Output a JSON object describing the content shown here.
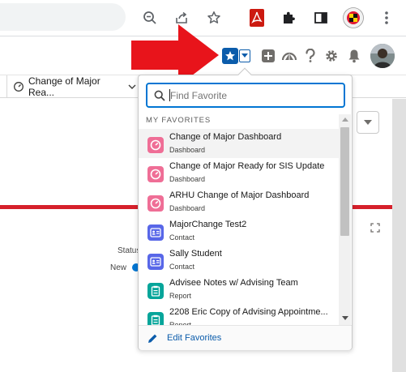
{
  "browser": {
    "toolbar_icons": [
      "zoom-icon",
      "share-icon",
      "bookmark-star-icon",
      "pdf-extension-icon",
      "extensions-puzzle-icon",
      "side-panel-icon",
      "profile-seal-icon"
    ]
  },
  "salesforce_header": {
    "icons": [
      "favorites-star-icon",
      "favorites-dropdown-icon",
      "global-actions-icon",
      "trailhead-icon",
      "help-icon",
      "setup-gear-icon",
      "notifications-bell-icon",
      "user-avatar"
    ]
  },
  "nav": {
    "tab_label": "Change of Major Rea..."
  },
  "page": {
    "status_label": "Status",
    "new_label": "New"
  },
  "favorites": {
    "search_placeholder": "Find Favorite",
    "section_title": "MY FAVORITES",
    "items": [
      {
        "title": "Change of Major Dashboard",
        "type": "Dashboard",
        "icon": "dashboard-icon",
        "color": "#ef6e96"
      },
      {
        "title": "Change of Major Ready for SIS Update",
        "type": "Dashboard",
        "icon": "dashboard-icon",
        "color": "#ef6e96"
      },
      {
        "title": "ARHU Change of Major Dashboard",
        "type": "Dashboard",
        "icon": "dashboard-icon",
        "color": "#ef6e96"
      },
      {
        "title": "MajorChange Test2",
        "type": "Contact",
        "icon": "contact-icon",
        "color": "#5867e8"
      },
      {
        "title": "Sally Student",
        "type": "Contact",
        "icon": "contact-icon",
        "color": "#5867e8"
      },
      {
        "title": "Advisee Notes w/ Advising Team",
        "type": "Report",
        "icon": "report-icon",
        "color": "#06a59a"
      },
      {
        "title": "2208 Eric Copy of Advising Appointme...",
        "type": "Report",
        "icon": "report-icon",
        "color": "#06a59a"
      }
    ],
    "edit_label": "Edit Favorites"
  },
  "colors": {
    "accent": "#0176d3",
    "arrow": "#e8141b",
    "brand_red": "#d6202b"
  }
}
